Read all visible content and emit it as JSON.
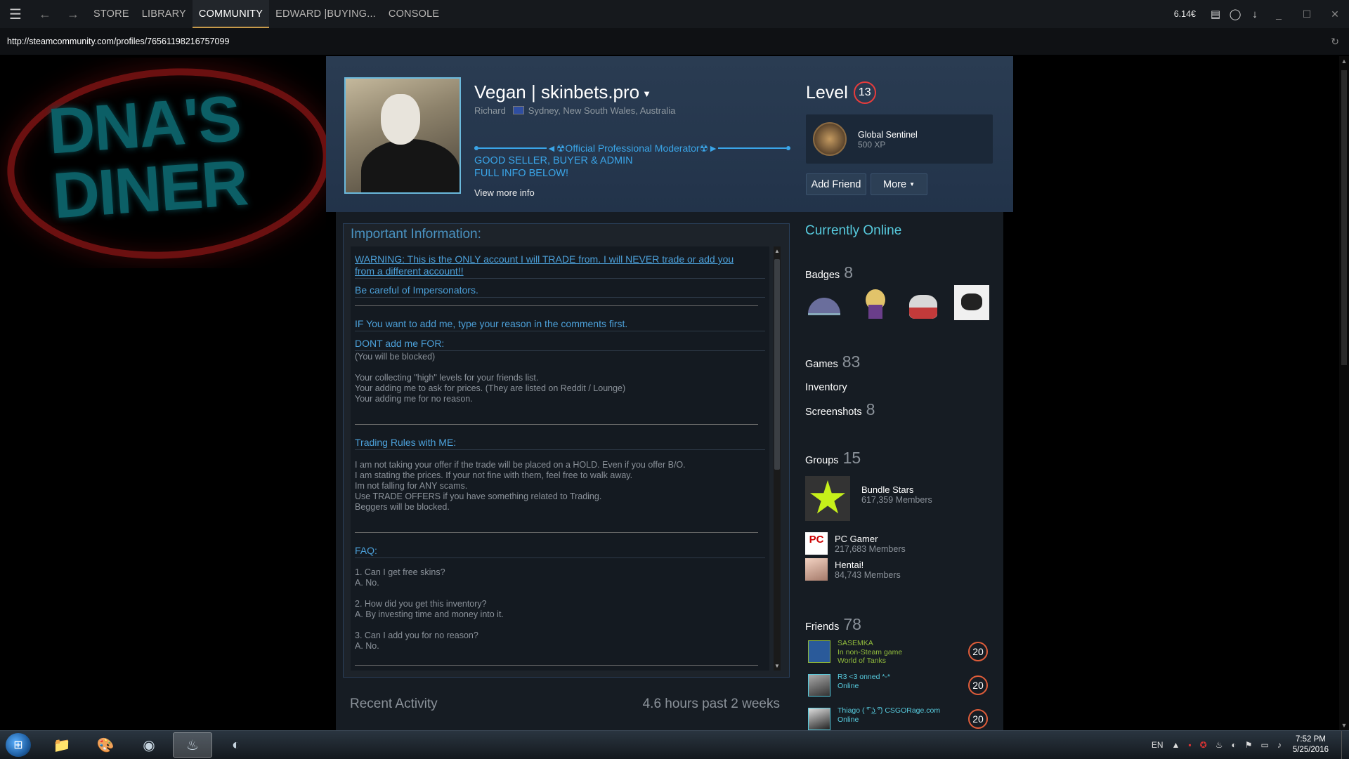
{
  "topbar": {
    "tabs": [
      {
        "label": "STORE",
        "active": false
      },
      {
        "label": "LIBRARY",
        "active": false
      },
      {
        "label": "COMMUNITY",
        "active": true
      },
      {
        "label": "EDWARD |BUYING...",
        "active": false
      },
      {
        "label": "CONSOLE",
        "active": false
      }
    ],
    "wallet": "6.14€",
    "icons": [
      "menu-icon",
      "back-icon",
      "forward-icon",
      "chat-icon",
      "friends-icon",
      "download-icon",
      "minimize-icon",
      "maximize-icon",
      "close-icon"
    ]
  },
  "urlbar": {
    "url": "http://steamcommunity.com/profiles/76561198216757099"
  },
  "background_sign": {
    "line1": "DNA'S",
    "line2": "DINER"
  },
  "profile": {
    "persona_name": "Vegan | skinbets.pro",
    "real_name": "Richard",
    "location": "Sydney, New South Wales, Australia",
    "moderator_line": "◄☢Official Professional Moderator☢►",
    "summary_line1": "GOOD SELLER, BUYER & ADMIN",
    "summary_line2": "FULL INFO BELOW!",
    "view_more": "View more info",
    "level_label": "Level",
    "level_value": "13",
    "featured_badge_name": "Global Sentinel",
    "featured_badge_xp": "500 XP",
    "add_friend": "Add Friend",
    "more": "More"
  },
  "info": {
    "title": "Important Information:",
    "warning": "WARNING: This is the ONLY account I will TRADE from. I will NEVER trade or add you",
    "warning2": "from a different account!!",
    "careful": "Be careful of Impersonators.",
    "if_add": "IF You want to add me, type your reason in the comments first.",
    "dont_add": "DONT add me FOR:",
    "blocked": "(You will be blocked)",
    "dont_reasons": [
      "Your collecting \"high\" levels for your friends list.",
      "Your adding me to ask for prices. (They are listed on Reddit / Lounge)",
      "Your adding me for no reason."
    ],
    "trading_title": "Trading Rules with ME:",
    "trading_rules": [
      "I am not taking your offer if the trade will be placed on a HOLD. Even if you offer B/O.",
      "I am stating the prices. If your not fine with them, feel free to walk away.",
      "Im not falling for ANY scams.",
      "Use TRADE OFFERS if you have something related to Trading.",
      "Beggers will be blocked."
    ],
    "faq_title": "FAQ:",
    "faq": [
      {
        "q": "1. Can I get free skins?",
        "a": "A. No."
      },
      {
        "q": "2. How did you get this inventory?",
        "a": "A. By investing time and money into it."
      },
      {
        "q": "3. Can I add you for no reason?",
        "a": "A. No."
      }
    ]
  },
  "recent": {
    "title": "Recent Activity",
    "hours": "4.6 hours past 2 weeks"
  },
  "sidebar": {
    "status": "Currently Online",
    "badges_label": "Badges",
    "badges_count": "8",
    "games_label": "Games",
    "games_count": "83",
    "inventory_label": "Inventory",
    "screenshots_label": "Screenshots",
    "screenshots_count": "8",
    "groups_label": "Groups",
    "groups_count": "15",
    "groups": [
      {
        "name": "Bundle Stars",
        "members": "617,359 Members"
      },
      {
        "name": "PC Gamer",
        "members": "217,683 Members"
      },
      {
        "name": "Hentai!",
        "members": "84,743 Members"
      }
    ],
    "friends_label": "Friends",
    "friends_count": "78",
    "friends": [
      {
        "name": "SASEMKA",
        "status": "In non-Steam game",
        "game": "World of Tanks",
        "level": "20"
      },
      {
        "name": "R3 <3 onned *-*",
        "status": "Online",
        "game": "",
        "level": "20"
      },
      {
        "name": "Thiago ( ͡° ͜ʖ ͡°) CSGORage.com",
        "status": "Online",
        "game": "",
        "level": "20"
      }
    ]
  },
  "taskbar": {
    "lang": "EN",
    "time": "7:52 PM",
    "date": "5/25/2016"
  }
}
